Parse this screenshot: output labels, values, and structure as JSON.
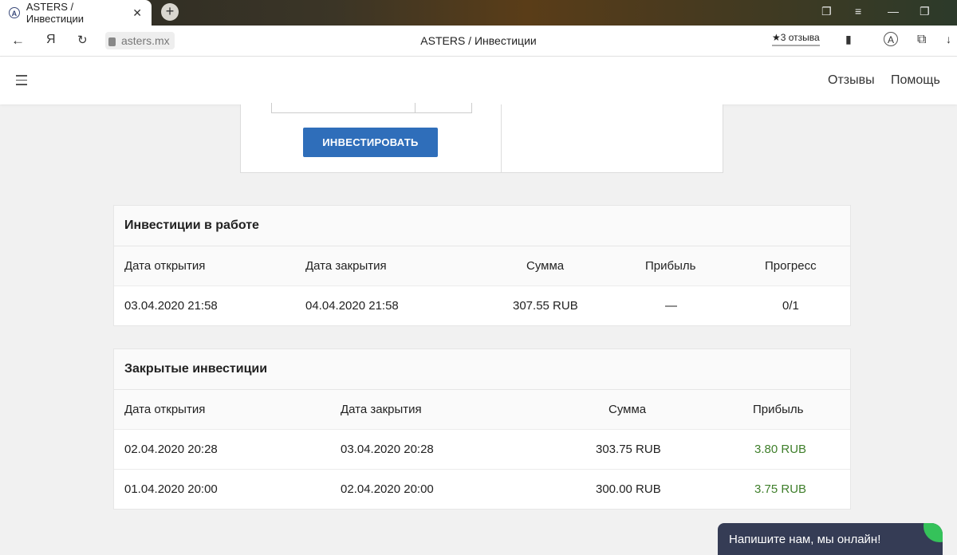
{
  "browser": {
    "tab_title": "ASTERS / Инвестиции",
    "tab_close": "✕",
    "new_tab": "+",
    "url": "asters.mx",
    "page_title": "ASTERS / Инвестиции",
    "reviews": "★3 отзыва",
    "yandex_glyph": "Я"
  },
  "header": {
    "nav": [
      "Отзывы",
      "Помощь"
    ]
  },
  "invest_form": {
    "button_label": "ИНВЕСТИРОВАТЬ"
  },
  "active_investments": {
    "title": "Инвестиции в работе",
    "columns": [
      "Дата открытия",
      "Дата закрытия",
      "Сумма",
      "Прибыль",
      "Прогресс"
    ],
    "rows": [
      {
        "open": "03.04.2020 21:58",
        "close": "04.04.2020 21:58",
        "amount": "307.55 RUB",
        "profit": "—",
        "progress": "0/1"
      }
    ]
  },
  "closed_investments": {
    "title": "Закрытые инвестиции",
    "columns": [
      "Дата открытия",
      "Дата закрытия",
      "Сумма",
      "Прибыль"
    ],
    "rows": [
      {
        "open": "02.04.2020 20:28",
        "close": "03.04.2020 20:28",
        "amount": "303.75 RUB",
        "profit": "3.80 RUB"
      },
      {
        "open": "01.04.2020 20:00",
        "close": "02.04.2020 20:00",
        "amount": "300.00 RUB",
        "profit": "3.75 RUB"
      }
    ]
  },
  "chat": {
    "label": "Напишите нам, мы онлайн!"
  },
  "colors": {
    "primary_button": "#2f6eba",
    "profit_positive": "#3f7f2b",
    "chat_bg": "#353c55",
    "online_dot": "#35c25a"
  }
}
